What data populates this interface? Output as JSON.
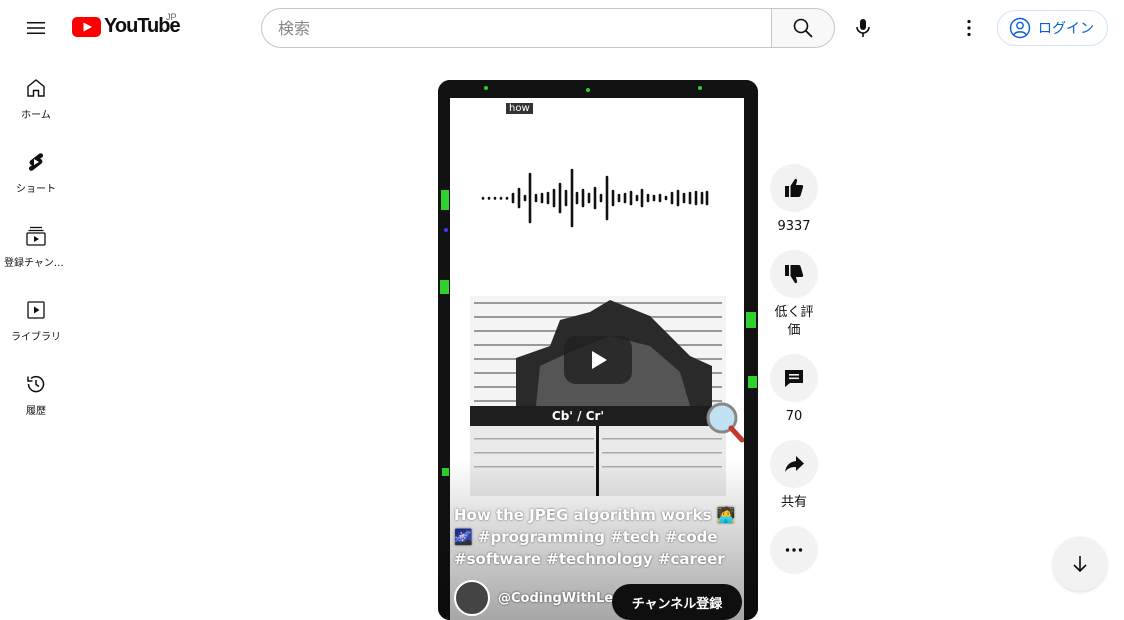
{
  "header": {
    "logo_text": "YouTube",
    "country_code": "JP",
    "search_placeholder": "検索",
    "login_label": "ログイン"
  },
  "guide": {
    "items": [
      {
        "label": "ホーム",
        "icon": "home-icon"
      },
      {
        "label": "ショート",
        "icon": "shorts-icon"
      },
      {
        "label": "登録チャンネル",
        "icon": "subscriptions-icon"
      },
      {
        "label": "ライブラリ",
        "icon": "library-icon"
      },
      {
        "label": "履歴",
        "icon": "history-icon"
      }
    ]
  },
  "short": {
    "overlay_tag": "how",
    "title": "How the JPEG algorithm works 🧑‍💻🌌 #programming #tech #code #software #technology #career",
    "channel_name": "@CodingWithLewi",
    "subscribe_label": "チャンネル登録",
    "panel_label": "Cb' / Cr'"
  },
  "actions": {
    "like_count": "9337",
    "dislike_label": "低く評価",
    "comment_count": "70",
    "share_label": "共有"
  },
  "colors": {
    "brand_red": "#ff0000",
    "link_blue": "#065fd4",
    "border_gray": "#c6c6c6"
  }
}
